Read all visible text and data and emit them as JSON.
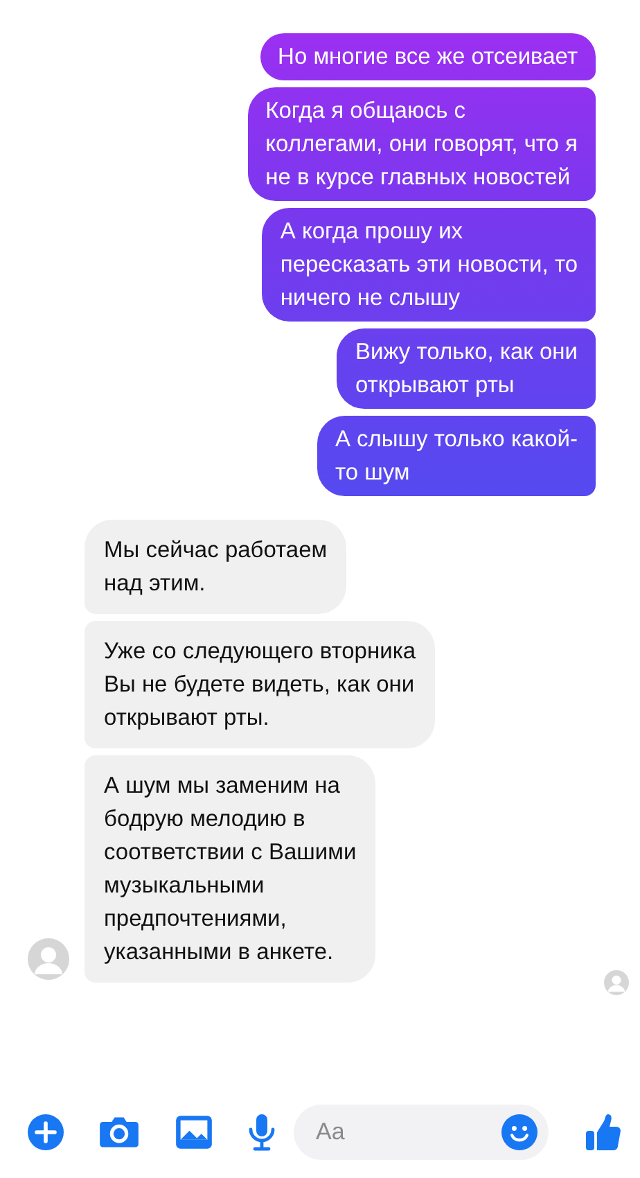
{
  "messages": [
    {
      "kind": "sent",
      "lines": [
        "Но многие все же отсеивает"
      ]
    },
    {
      "kind": "sent",
      "lines": [
        "Когда я общаюсь с",
        "коллегами, они говорят, что я",
        "не в курсе главных новостей"
      ]
    },
    {
      "kind": "sent",
      "lines": [
        "А когда прошу их",
        "пересказать эти новости, то",
        "ничего не слышу"
      ]
    },
    {
      "kind": "sent",
      "lines": [
        "Вижу только, как они",
        "открывают рты"
      ]
    },
    {
      "kind": "sent",
      "lines": [
        "А слышу только какой-",
        "то шум"
      ]
    },
    {
      "kind": "received",
      "lines": [
        "Мы сейчас работаем",
        "над этим."
      ]
    },
    {
      "kind": "received",
      "lines": [
        "Уже со следующего вторника",
        "Вы не будете видеть, как они",
        "открывают рты."
      ]
    },
    {
      "kind": "received",
      "lines": [
        "А шум мы заменим на",
        "бодрую мелодию в",
        "соответствии с Вашими",
        "музыкальными",
        "предпочтениями,",
        "указанными в анкете."
      ]
    }
  ],
  "composer": {
    "placeholder": "Aa"
  }
}
